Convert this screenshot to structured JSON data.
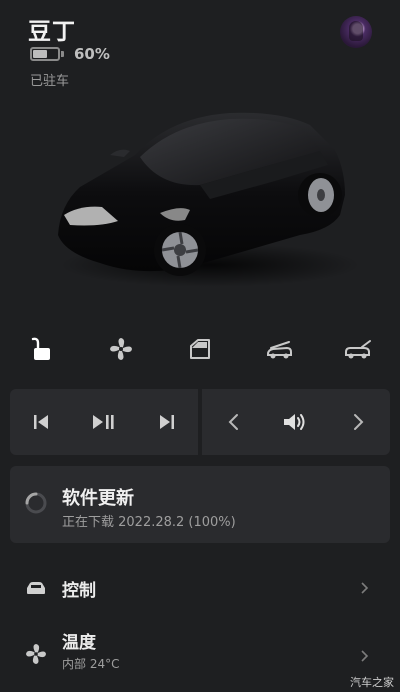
{
  "header": {
    "car_name": "豆丁",
    "battery_percent": "60%",
    "battery_level": 0.6,
    "status": "已驻车"
  },
  "quick_controls": [
    {
      "icon": "unlock-icon"
    },
    {
      "icon": "fan-icon"
    },
    {
      "icon": "window-icon"
    },
    {
      "icon": "frunk-icon"
    },
    {
      "icon": "trunk-icon"
    }
  ],
  "media": {
    "left": [
      "previous-track-icon",
      "play-pause-icon",
      "next-track-icon"
    ],
    "right": [
      "prev-source-icon",
      "volume-icon",
      "next-source-icon"
    ]
  },
  "update": {
    "title": "软件更新",
    "subtitle": "正在下载 2022.28.2 (100%)"
  },
  "menu": {
    "controls_label": "控制",
    "climate_label": "温度",
    "climate_sub": "内部 24°C"
  },
  "watermark": "汽车之家",
  "colors": {
    "background": "#1e1f21",
    "card": "#2a2b2e",
    "text_primary": "#f0f0f0",
    "text_secondary": "#9e9e9e"
  }
}
